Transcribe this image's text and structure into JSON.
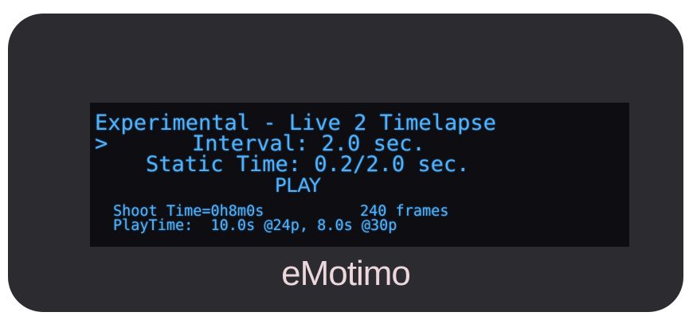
{
  "lcd": {
    "title": "Experimental - Live 2 Timelapse",
    "cursor": ">",
    "interval": "Interval: 2.0 sec.",
    "static_time": "Static Time: 0.2/2.0 sec.",
    "play": "PLAY",
    "shoot_time": "Shoot Time=0h8m0s",
    "frames": "240 frames",
    "play_time": "PlayTime:  10.0s @24p, 8.0s @30p",
    "text_color": "#4fb2ff",
    "background_color": "#0d0d12"
  },
  "brand": {
    "logo": "eMotimo",
    "color": "#ecd7dc"
  },
  "device": {
    "body_color": "#2c2b30"
  }
}
